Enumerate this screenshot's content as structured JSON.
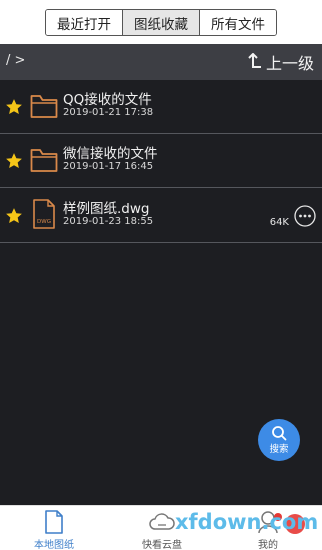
{
  "tabs": [
    {
      "label": "最近打开",
      "active": false
    },
    {
      "label": "图纸收藏",
      "active": true
    },
    {
      "label": "所有文件",
      "active": false
    }
  ],
  "path": {
    "text": "/ >",
    "up_label": "上一级"
  },
  "files": [
    {
      "name": "QQ接收的文件",
      "date": "2019-01-21 17:38",
      "type": "folder",
      "starred": true,
      "size": ""
    },
    {
      "name": "微信接收的文件",
      "date": "2019-01-17 16:45",
      "type": "folder",
      "starred": true,
      "size": ""
    },
    {
      "name": "样例图纸.dwg",
      "date": "2019-01-23 18:55",
      "type": "dwg",
      "icon_text": "DWG",
      "starred": true,
      "size": "64K"
    }
  ],
  "search": {
    "label": "搜索"
  },
  "bottom_nav": [
    {
      "label": "本地图纸",
      "icon": "document-icon",
      "active": true
    },
    {
      "label": "快看云盘",
      "icon": "cloud-icon",
      "active": false
    },
    {
      "label": "我的",
      "icon": "person-icon",
      "active": false
    }
  ],
  "watermark": {
    "text": "xfdown.com"
  },
  "colors": {
    "accent": "#3d8be6",
    "star": "#f5c518",
    "folder": "#d9894a",
    "dark_bg": "#1d1e22",
    "pathbar": "#3d3e44"
  }
}
